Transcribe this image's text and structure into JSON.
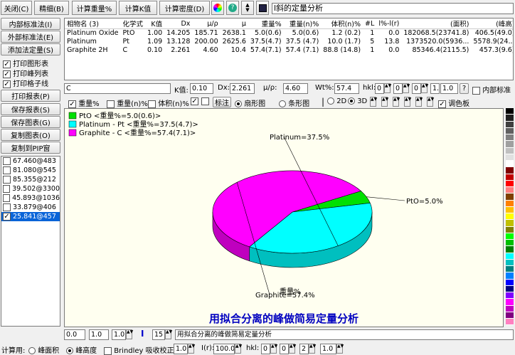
{
  "toolbar": {
    "close": "关闭(C)",
    "detail": "精细(B)",
    "calc_wt": "计算重量%",
    "calc_k": "计算K值",
    "calc_density": "计算密度(D)",
    "title_field": "l斜的定量分析"
  },
  "left": {
    "internal": "内部标准法(I)",
    "external": "外部标准法(E)",
    "additive": "添加法定量(S)",
    "chk_print_chart": "打印图形表",
    "chk_print_peaks": "打印峰列表",
    "chk_print_grid": "打印格子线",
    "print_report": "打印报表(P)",
    "save_report": "保存报表(S)",
    "save_chart": "保存图表(G)",
    "copy_chart": "复制图表(O)",
    "copy_pip": "复制到PIP窗",
    "list": [
      "67.460@483",
      "81.080@545",
      "85.355@212",
      "39.502@3300",
      "45.893@1036",
      "33.879@406",
      "25.841@457"
    ]
  },
  "table": {
    "headers": [
      "相物名 (3)",
      "化学式",
      "K值",
      "Dx",
      "μ/ρ",
      "μ",
      "重量%",
      "重量(n)%",
      "体积(n)%",
      "#L",
      "l%-l(r)",
      "(面积)",
      "(峰高)"
    ],
    "rows": [
      [
        "Platinum Oxide",
        "PtO",
        "1.00",
        "14.205",
        "185.71",
        "2638.1",
        "5.0(0.6)",
        "5.0(0.6)",
        "1.2 (0.2)",
        "1",
        "0.0",
        "182068.5(23741.8)",
        "406.5(49.0)"
      ],
      [
        "Platinum",
        "Pt",
        "1.09",
        "13.128",
        "200.00",
        "2625.6",
        "37.5(4.7)",
        "37.5 (4.7)",
        "10.0 (1.7)",
        "5",
        "13.8",
        "1373520.0(5936...",
        "5578.9(24..."
      ],
      [
        "Graphite 2H",
        "C",
        "0.10",
        "2.261",
        "4.60",
        "10.4",
        "57.4(7.1)",
        "57.4 (7.1)",
        "88.8 (14.8)",
        "1",
        "0.0",
        "85346.4(2115.5)",
        "457.3(9.6)"
      ]
    ]
  },
  "edit": {
    "name": "C",
    "k_label": "K值:",
    "k_value": "0.10",
    "dx_label": "Dx:",
    "dx_value": "2.261",
    "mu_label": "μ/ρ:",
    "mu_value": "4.60",
    "wt_label": "Wt%:",
    "wt_value": "57.4",
    "hkl_label": "hkl:",
    "h": "0",
    "k": "0",
    "l": "0",
    "r": "1.0",
    "help": "?",
    "internal": "内部标准"
  },
  "chartbar": {
    "wt": "重量%",
    "wtn": "重量(n)%",
    "voln": "体积(n)%",
    "title": "标注",
    "pie": "扇形图",
    "bar": "条形图",
    "d2": "2D",
    "d3": "3D",
    "palette": "调色板"
  },
  "chart_data": {
    "type": "pie",
    "legend": [
      "PtO <重量%=5.0(0.6)>",
      "Platinum - Pt <重量%=37.5(4.7)>",
      "Graphite - C <重量%=57.4(7.1)>"
    ],
    "slices": [
      {
        "label": "PtO=5.0%",
        "value": 5.0,
        "color": "#00e000"
      },
      {
        "label": "Platinum=37.5%",
        "value": 37.5,
        "color": "#00ffff"
      },
      {
        "label": "Graphite=57.4%",
        "value": 57.4,
        "color": "#ff00ff"
      }
    ],
    "axis_label": "重量%",
    "title": "用拟合分离的峰做简易定量分析"
  },
  "bottom": {
    "v1": "0.0",
    "v2": "1.0",
    "v3": "1.0",
    "v4": "15",
    "title_input": "用拟合分离的峰做简易定量分析"
  },
  "status": {
    "calc": "计算用:",
    "area": "峰面积",
    "height": "峰高度",
    "brindley": "Brindley 吸收校正",
    "b1": "1.0",
    "ir_label": "I(r):",
    "ir": "100.0",
    "hkl_label": "hkl:",
    "h": "0",
    "k": "0",
    "l": "2",
    "r": "1.0"
  },
  "palette": [
    "#000000",
    "#202020",
    "#404040",
    "#606060",
    "#808080",
    "#a0a0a0",
    "#c0c0c0",
    "#e0e0e0",
    "#ffffff",
    "#800000",
    "#c00000",
    "#ff0000",
    "#ff8080",
    "#804000",
    "#ff8000",
    "#ffc000",
    "#ffff00",
    "#c0c000",
    "#808000",
    "#00ff00",
    "#00c000",
    "#008000",
    "#00ffff",
    "#00c0c0",
    "#008080",
    "#0080ff",
    "#0000ff",
    "#000080",
    "#8000ff",
    "#ff00ff",
    "#c000c0",
    "#800080",
    "#ff80c0"
  ]
}
